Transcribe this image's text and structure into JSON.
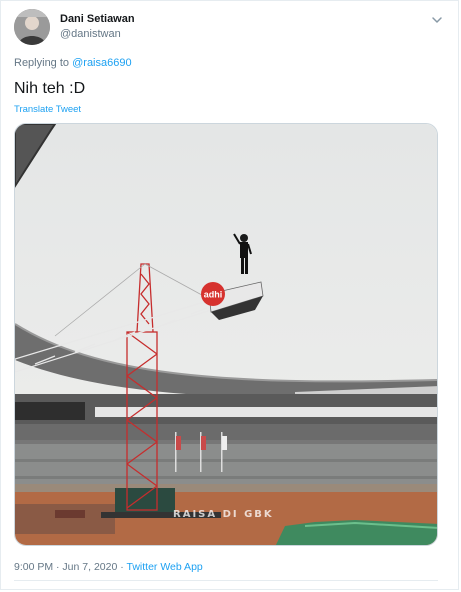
{
  "author": {
    "name": "Dani Setiawan",
    "handle": "@danistwan"
  },
  "reply": {
    "prefix": "Replying to",
    "to": "@raisa6690"
  },
  "tweet": {
    "text": "Nih teh :D",
    "translate_label": "Translate Tweet"
  },
  "media": {
    "banner_logo": "adhi",
    "watermark": "RAISA DI GBK"
  },
  "meta": {
    "timestamp": "9:00 PM · Jun 7, 2020",
    "separator": " · ",
    "app": "Twitter Web App"
  },
  "icons": {
    "menu": "chevron-down-icon"
  },
  "colors": {
    "accent": "#1da1f2",
    "secondary_text": "#657786",
    "primary_text": "#14171a"
  }
}
